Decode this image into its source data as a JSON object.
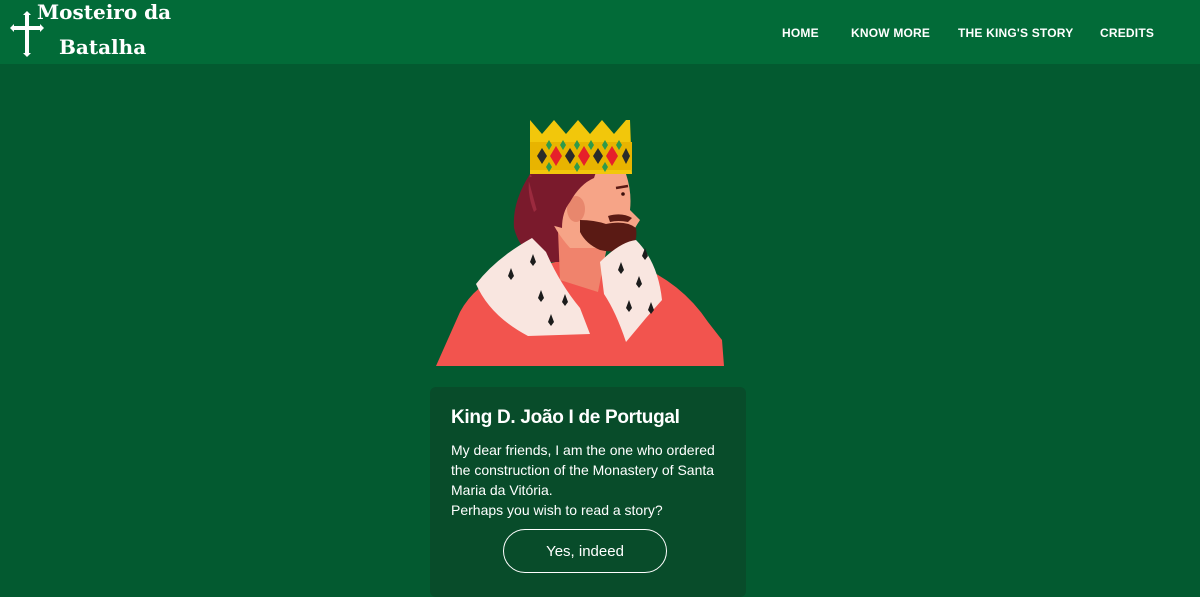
{
  "brand": {
    "line1": "Mosteiro da",
    "line2": "Batalha",
    "icon": "cross-icon"
  },
  "nav": {
    "home": "HOME",
    "know_more": "KNOW MORE",
    "kings_story": "THE KING'S STORY",
    "credits": "CREDITS"
  },
  "illustration": {
    "icon": "king-illustration"
  },
  "card": {
    "title": "King D. João I de Portugal",
    "lines": [
      "My dear friends, I am the one who ordered",
      "the construction of the Monastery of Santa",
      "Maria da Vitória.",
      "Perhaps you wish to read a story?"
    ],
    "button_label": "Yes, indeed"
  },
  "colors": {
    "navbar": "#026b38",
    "background": "#035a30",
    "card": "#084c2a",
    "text": "#ffffff",
    "crown": "#f2c70b",
    "robe": "#f2544e"
  }
}
